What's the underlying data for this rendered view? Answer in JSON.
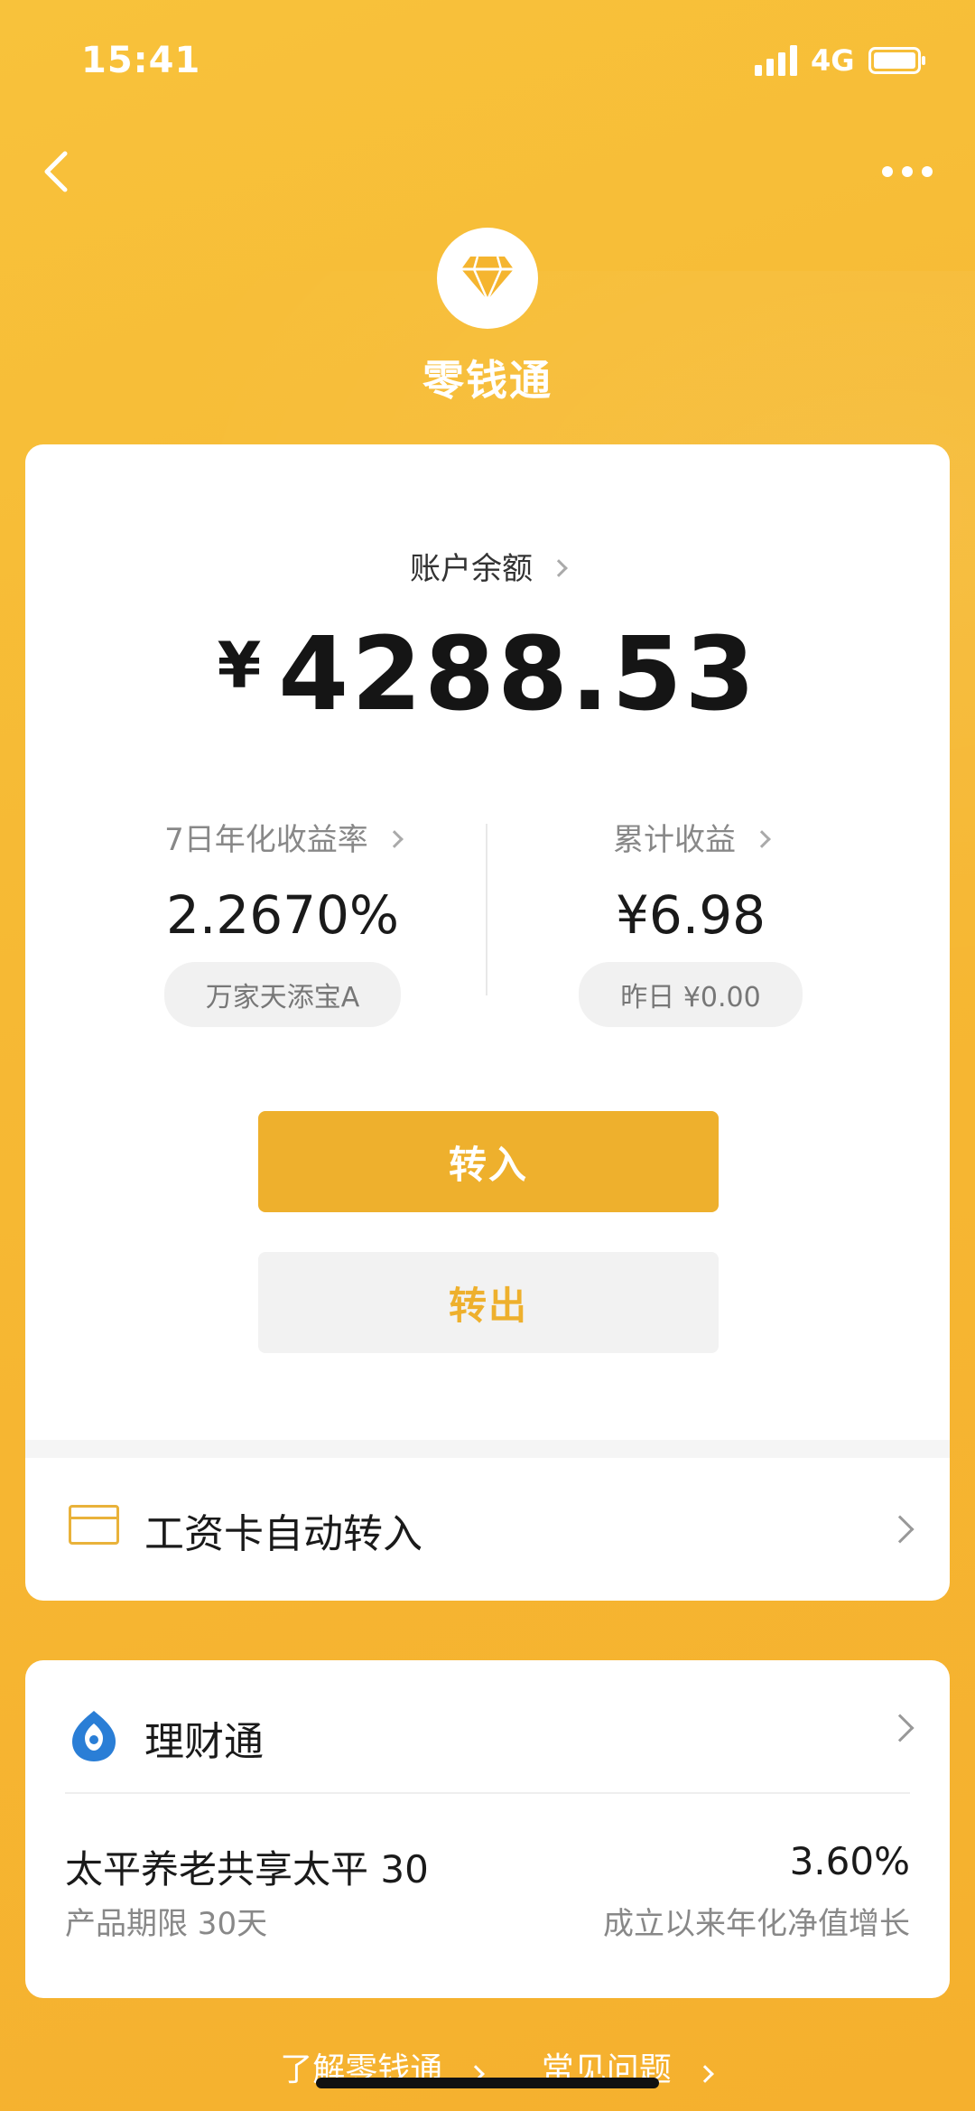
{
  "status_bar": {
    "time": "15:41",
    "network": "4G"
  },
  "header": {
    "title": "零钱通"
  },
  "balance": {
    "label": "账户余额",
    "currency": "¥",
    "amount": "4288.53"
  },
  "stats": {
    "yield": {
      "label": "7日年化收益率",
      "value": "2.2670%",
      "fund": "万家天添宝A"
    },
    "earnings": {
      "label": "累计收益",
      "value": "¥6.98",
      "yesterday": "昨日 ¥0.00"
    }
  },
  "actions": {
    "transfer_in": "转入",
    "transfer_out": "转出"
  },
  "salary": {
    "label": "工资卡自动转入"
  },
  "licaitong": {
    "title": "理财通",
    "product": {
      "name": "太平养老共享太平 30",
      "term": "产品期限 30天",
      "rate": "3.60%",
      "rate_label": "成立以来年化净值增长"
    }
  },
  "footer": {
    "learn": "了解零钱通",
    "faq": "常见问题"
  },
  "colors": {
    "accent": "#eeb02d",
    "background": "#f7bb35"
  }
}
